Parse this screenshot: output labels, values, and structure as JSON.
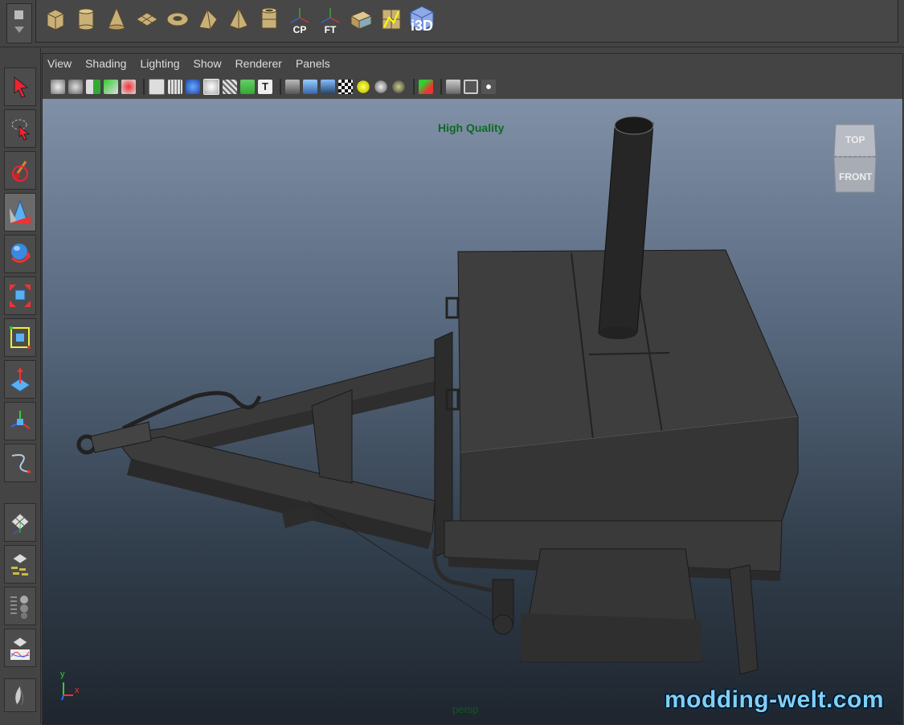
{
  "shelf": {
    "icons": [
      {
        "name": "poly-cube-icon"
      },
      {
        "name": "poly-cylinder-icon"
      },
      {
        "name": "poly-cone-icon"
      },
      {
        "name": "poly-plane-icon"
      },
      {
        "name": "poly-torus-icon"
      },
      {
        "name": "poly-prism-icon"
      },
      {
        "name": "poly-pyramid-icon"
      },
      {
        "name": "poly-pipe-icon"
      },
      {
        "name": "center-pivot-icon",
        "label": "CP"
      },
      {
        "name": "freeze-transform-icon",
        "label": "FT"
      },
      {
        "name": "uv-map-icon"
      },
      {
        "name": "uv-editor-icon"
      },
      {
        "name": "i3d-export-icon",
        "label": "i3D"
      }
    ]
  },
  "menubar": {
    "items": [
      "View",
      "Shading",
      "Lighting",
      "Show",
      "Renderer",
      "Panels"
    ]
  },
  "viewport": {
    "quality_label": "High Quality",
    "camera_label": "persp",
    "viewcube": {
      "top": "TOP",
      "front": "FRONT"
    },
    "axis": {
      "y": "y",
      "x": "x"
    },
    "watermark": "modding-welt.com",
    "background_top": "#8090a6",
    "background_bottom": "#1e252e",
    "model_color": "#3f3f3f"
  },
  "toolbox": {
    "tools": [
      "select-tool-icon",
      "lasso-tool-icon",
      "paint-select-tool-icon",
      "move-tool-icon",
      "rotate-tool-icon",
      "scale-tool-icon",
      "universal-manip-icon",
      "soft-mod-icon",
      "show-manip-icon",
      "curve-tool-icon",
      "single-layout-icon",
      "outliner-layout-icon",
      "channel-layout-icon",
      "graph-layout-icon",
      "custom-layout-icon"
    ]
  },
  "colors": {
    "ui_bg": "#444444",
    "quality_text": "#0d6a22",
    "watermark": "#7fd0ff"
  }
}
